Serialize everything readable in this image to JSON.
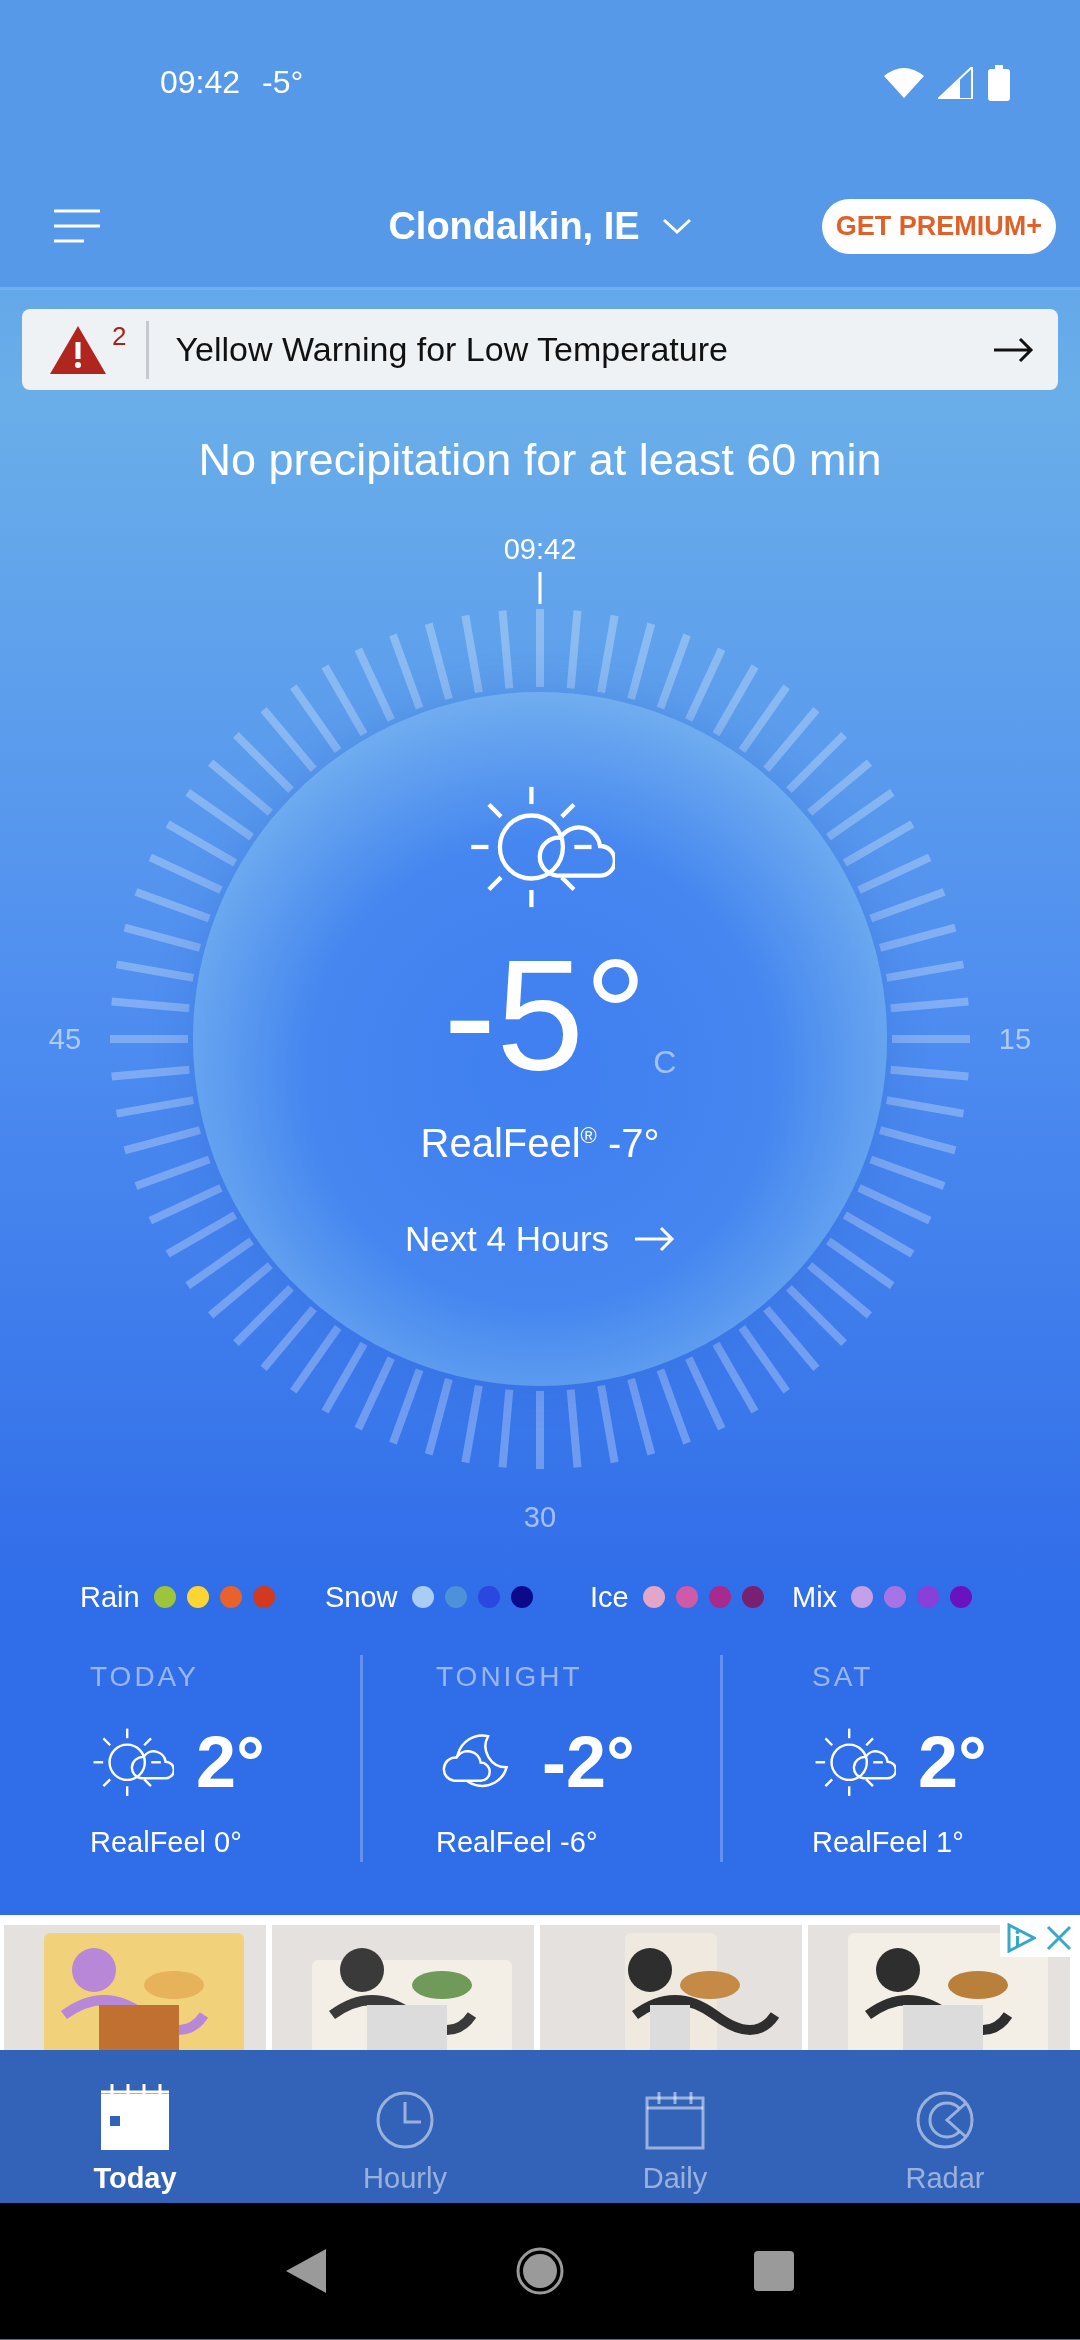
{
  "status_bar": {
    "time": "09:42",
    "temperature": "-5°"
  },
  "header": {
    "location": "Clondalkin, IE",
    "premium_button": "GET PREMIUM+"
  },
  "alert": {
    "count": "2",
    "text": "Yellow Warning for Low Temperature"
  },
  "precipitation_summary": "No precipitation for at least 60 min",
  "dial": {
    "top_label": "09:42",
    "left_label": "45",
    "right_label": "15",
    "bottom_label": "30"
  },
  "current": {
    "temperature": "-5°",
    "unit": "C",
    "realfeel": "RealFeel$^{®}$ -7°",
    "link": "Next 4 Hours"
  },
  "legend": [
    {
      "label": "Rain",
      "dots": [
        {
          "color": "#9dc43a"
        },
        {
          "color": "#fcd535"
        },
        {
          "color": "#e8632c"
        },
        {
          "color": "#d3391e"
        }
      ]
    },
    {
      "label": "Snow",
      "dots": [
        {
          "color": "#a9cdf5"
        },
        {
          "color": "#4d92d9"
        },
        {
          "color": "#2a47e0"
        },
        {
          "color": "#0a0a8a"
        }
      ]
    },
    {
      "label": "Ice",
      "dots": [
        {
          "color": "#e3a5c8"
        },
        {
          "color": "#cf5aa8"
        },
        {
          "color": "#a82a8e"
        },
        {
          "color": "#7a2070"
        }
      ]
    },
    {
      "label": "Mix",
      "dots": [
        {
          "color": "#c5a0e8"
        },
        {
          "color": "#a774e6"
        },
        {
          "color": "#8a3fd8"
        },
        {
          "color": "#6a12c0"
        }
      ]
    }
  ],
  "forecast": [
    {
      "label": "TODAY",
      "kind": "partly-sunny",
      "temperature": "2°",
      "realfeel": "RealFeel 0°"
    },
    {
      "label": "TONIGHT",
      "kind": "partly-cloudy-night",
      "temperature": "-2°",
      "realfeel": "RealFeel -6°"
    },
    {
      "label": "SAT",
      "kind": "partly-sunny",
      "temperature": "2°",
      "realfeel": "RealFeel 1°"
    }
  ],
  "tabs": [
    {
      "label": "Today",
      "kind": "today",
      "selected": true
    },
    {
      "label": "Hourly",
      "kind": "hourly",
      "selected": false
    },
    {
      "label": "Daily",
      "kind": "daily",
      "selected": false
    },
    {
      "label": "Radar",
      "kind": "radar",
      "selected": false
    }
  ]
}
